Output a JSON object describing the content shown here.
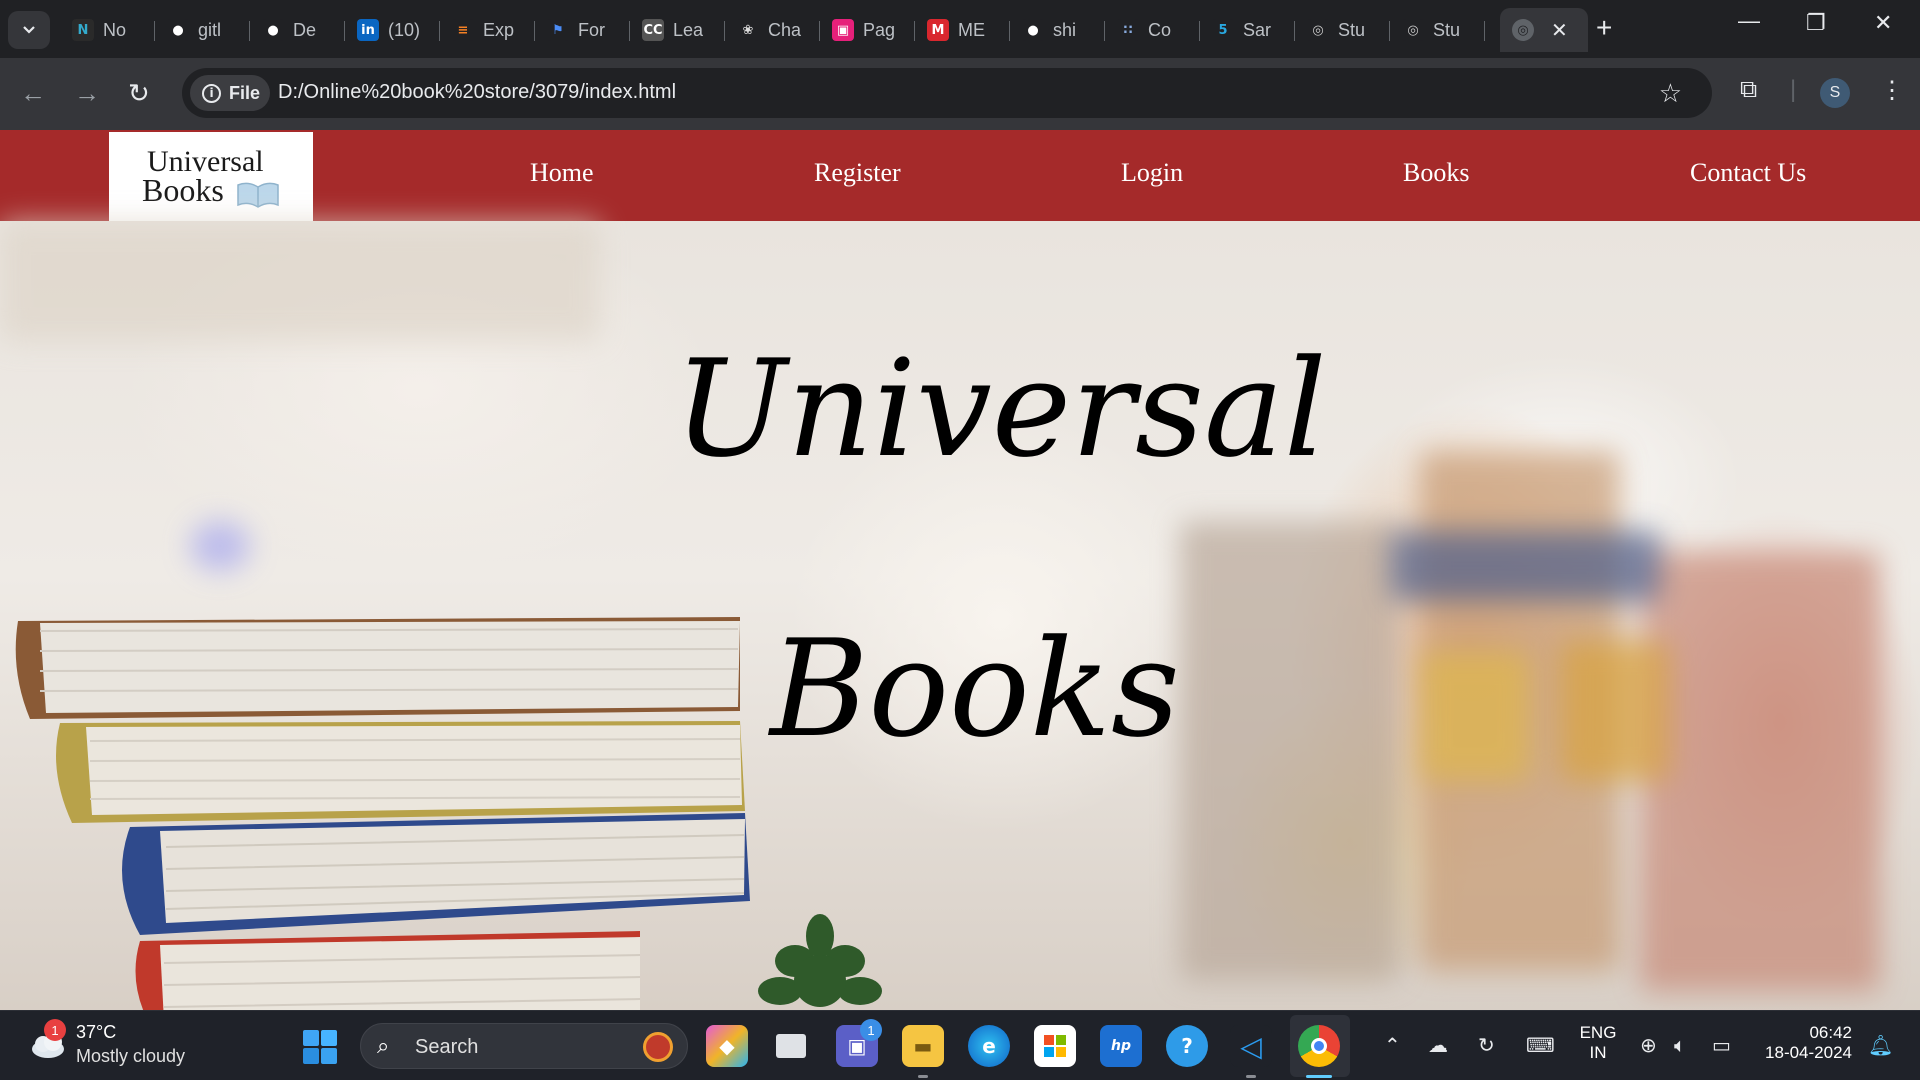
{
  "browser": {
    "tabs": [
      {
        "label": "No",
        "icon": "notion-icon",
        "color": "#2a2a2a",
        "glyph": "N",
        "fg": "#3ac"
      },
      {
        "label": "gitl",
        "icon": "github-icon",
        "color": "#202124",
        "glyph": "●",
        "fg": "#fff"
      },
      {
        "label": "De",
        "icon": "github-icon",
        "color": "#202124",
        "glyph": "●",
        "fg": "#fff"
      },
      {
        "label": "(10)",
        "icon": "linkedin-icon",
        "color": "#0a66c2",
        "glyph": "in",
        "fg": "#fff"
      },
      {
        "label": "Exp",
        "icon": "stackoverflow-icon",
        "color": "#202124",
        "glyph": "≡",
        "fg": "#f48024"
      },
      {
        "label": "For",
        "icon": "flag-icon",
        "color": "#202124",
        "glyph": "⚑",
        "fg": "#4b8cf5"
      },
      {
        "label": "Lea",
        "icon": "cc-icon",
        "color": "#555",
        "glyph": "CC",
        "fg": "#fff"
      },
      {
        "label": "Cha",
        "icon": "chatgpt-icon",
        "color": "#202124",
        "glyph": "❀",
        "fg": "#ddd"
      },
      {
        "label": "Pag",
        "icon": "page-icon",
        "color": "#e6207a",
        "glyph": "▣",
        "fg": "#fff"
      },
      {
        "label": "ME",
        "icon": "mega-icon",
        "color": "#d9272e",
        "glyph": "M",
        "fg": "#fff"
      },
      {
        "label": "shi",
        "icon": "github-icon",
        "color": "#202124",
        "glyph": "●",
        "fg": "#fff"
      },
      {
        "label": "Co",
        "icon": "coursera-icon",
        "color": "#202124",
        "glyph": "∷",
        "fg": "#8ad"
      },
      {
        "label": "Sar",
        "icon": "css-icon",
        "color": "#202124",
        "glyph": "5",
        "fg": "#29a8e0"
      },
      {
        "label": "Stu",
        "icon": "globe-icon",
        "color": "#202124",
        "glyph": "◎",
        "fg": "#ccc"
      },
      {
        "label": "Stu",
        "icon": "globe-icon",
        "color": "#202124",
        "glyph": "◎",
        "fg": "#ccc"
      }
    ],
    "active_tab_icon": "globe-icon",
    "chip_label": "File",
    "url": "D:/Online%20book%20store/3079/index.html",
    "profile_initial": "S"
  },
  "site": {
    "logo_line1": "Universal",
    "logo_line2": "Books",
    "nav": [
      {
        "label": "Home"
      },
      {
        "label": "Register"
      },
      {
        "label": "Login"
      },
      {
        "label": "Books"
      },
      {
        "label": "Contact Us"
      }
    ],
    "hero_line1": "Universal",
    "hero_line2": "Books",
    "brand_color": "#a52a2a"
  },
  "taskbar": {
    "weather_badge": "1",
    "temperature": "37°C",
    "condition": "Mostly cloudy",
    "search_label": "Search",
    "teams_badge": "1",
    "lang1": "ENG",
    "lang2": "IN",
    "time": "06:42",
    "date": "18-04-2024"
  }
}
